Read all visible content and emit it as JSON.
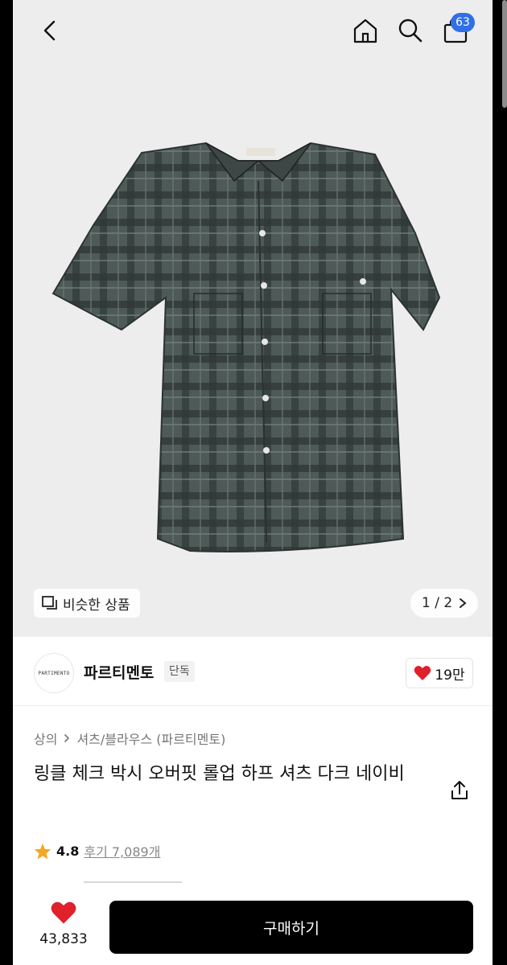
{
  "topbar": {
    "back_icon": "chevron-left-icon",
    "home_icon": "home-icon",
    "search_icon": "search-icon",
    "cart_icon": "shopping-bag-icon",
    "cart_count": "63"
  },
  "gallery": {
    "similar_label": "비슷한 상품",
    "pager": "1 / 2"
  },
  "brand": {
    "logo_text": "PARTIMENTO",
    "name": "파르티멘토",
    "tag": "단독",
    "likes": "19만"
  },
  "product": {
    "breadcrumb": [
      "상의",
      "셔츠/블라우스 (파르티멘토)"
    ],
    "title": "링클 체크 박시 오버핏 롤업 하프 셔츠 다크 네이비",
    "rating": "4.8",
    "review_label": "후기 7,089개"
  },
  "bottom": {
    "like_count": "43,833",
    "buy_label": "구매하기"
  },
  "colors": {
    "accent_badge": "#2f6fe8",
    "heart": "#e0202b",
    "star": "#f5a623",
    "buy_button": "#000000"
  }
}
